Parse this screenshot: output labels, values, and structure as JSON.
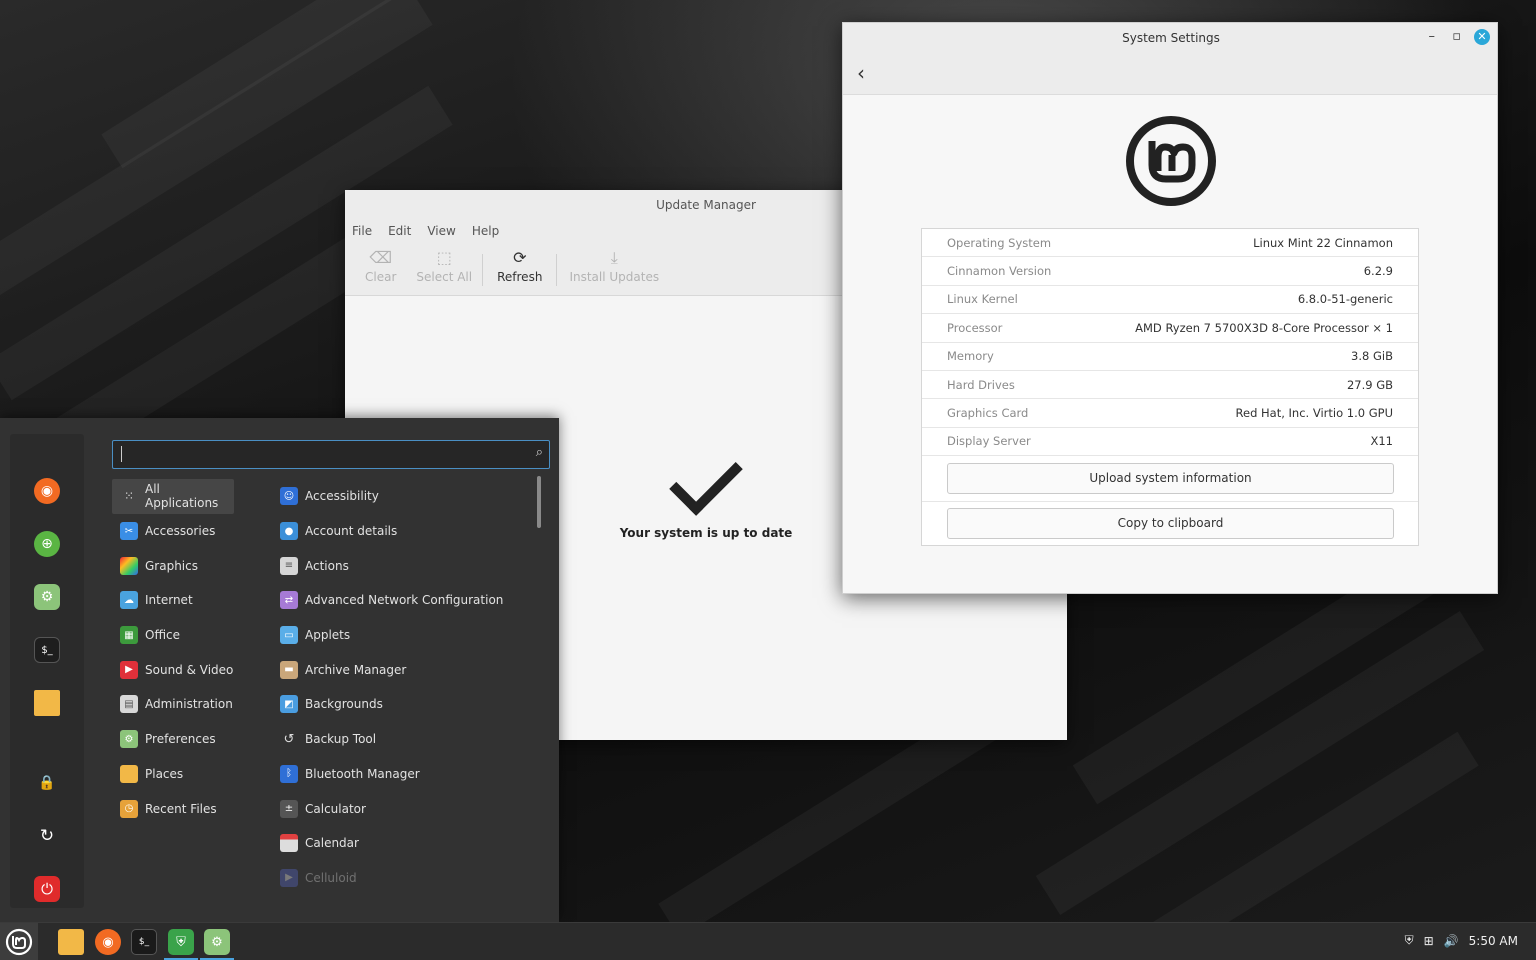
{
  "update_manager": {
    "title": "Update Manager",
    "menu": [
      "File",
      "Edit",
      "View",
      "Help"
    ],
    "toolbar": {
      "clear_label": "Clear",
      "select_all_label": "Select All",
      "refresh_label": "Refresh",
      "install_label": "Install Updates"
    },
    "status_text": "Your system is up to date"
  },
  "system_settings": {
    "title": "System Settings",
    "info": [
      {
        "key": "Operating System",
        "value": "Linux Mint 22 Cinnamon"
      },
      {
        "key": "Cinnamon Version",
        "value": "6.2.9"
      },
      {
        "key": "Linux Kernel",
        "value": "6.8.0-51-generic"
      },
      {
        "key": "Processor",
        "value": "AMD Ryzen 7 5700X3D 8-Core Processor × 1"
      },
      {
        "key": "Memory",
        "value": "3.8 GiB"
      },
      {
        "key": "Hard Drives",
        "value": "27.9 GB"
      },
      {
        "key": "Graphics Card",
        "value": "Red Hat, Inc. Virtio 1.0 GPU"
      },
      {
        "key": "Display Server",
        "value": "X11"
      }
    ],
    "upload_button": "Upload system information",
    "copy_button": "Copy to clipboard"
  },
  "app_menu": {
    "search_value": "",
    "categories": [
      "All Applications",
      "Accessories",
      "Graphics",
      "Internet",
      "Office",
      "Sound & Video",
      "Administration",
      "Preferences",
      "Places",
      "Recent Files"
    ],
    "apps": [
      "Accessibility",
      "Account details",
      "Actions",
      "Advanced Network Configuration",
      "Applets",
      "Archive Manager",
      "Backgrounds",
      "Backup Tool",
      "Bluetooth Manager",
      "Calculator",
      "Calendar",
      "Celluloid"
    ],
    "favorites": [
      "firefox",
      "web-apps",
      "system-settings",
      "terminal",
      "files"
    ],
    "session": [
      "lock-screen",
      "logout",
      "shutdown"
    ]
  },
  "panel": {
    "clock": "5:50 AM",
    "launchers": [
      "files",
      "firefox",
      "terminal",
      "update-manager",
      "system-settings"
    ]
  },
  "colors": {
    "accent": "#4aa3df",
    "firefox": "#f26a22",
    "close_button": "#2aa7d8",
    "menu_background": "#323232"
  }
}
